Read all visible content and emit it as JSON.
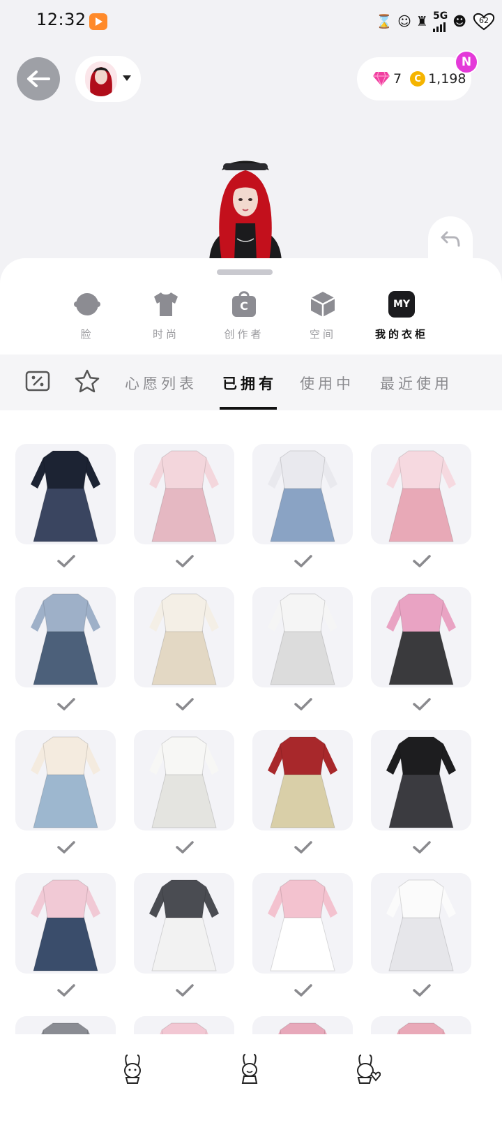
{
  "status_bar": {
    "time": "12:32",
    "battery": "62"
  },
  "wallet": {
    "gems": "7",
    "coins": "1,198",
    "coin_symbol": "C",
    "badge": "N"
  },
  "categories": [
    {
      "label": "脸",
      "icon": "face-icon"
    },
    {
      "label": "时尚",
      "icon": "tshirt-icon"
    },
    {
      "label": "创作者",
      "icon": "creator-bag-icon",
      "glyph": "C"
    },
    {
      "label": "空间",
      "icon": "space-cube-icon"
    },
    {
      "label": "我的衣柜",
      "icon": "my-closet-icon",
      "glyph": "MY",
      "active": true
    }
  ],
  "tabs": [
    {
      "label": "心愿列表"
    },
    {
      "label": "已拥有",
      "active": true
    },
    {
      "label": "使用中"
    },
    {
      "label": "最近使用"
    }
  ],
  "items": [
    {
      "name": "dark-starry-gown",
      "colors": [
        "#1c2333",
        "#3a4560"
      ],
      "owned": true
    },
    {
      "name": "pink-draped-dress",
      "colors": [
        "#f3d6dc",
        "#e5b8c2"
      ],
      "owned": true
    },
    {
      "name": "white-top-flare-jeans",
      "colors": [
        "#e9e9ee",
        "#8aa3c4"
      ],
      "owned": true
    },
    {
      "name": "cherry-blossom-set",
      "colors": [
        "#f6d9e0",
        "#e8a9b7"
      ],
      "owned": true
    },
    {
      "name": "denim-crop-set",
      "colors": [
        "#9eb0c8",
        "#4c607a"
      ],
      "owned": true
    },
    {
      "name": "white-lace-gown",
      "colors": [
        "#f4efe6",
        "#e3d8c4"
      ],
      "owned": true
    },
    {
      "name": "white-bubble-dress",
      "colors": [
        "#f5f5f5",
        "#dcdcdc"
      ],
      "owned": true
    },
    {
      "name": "pink-top-black-skirt",
      "colors": [
        "#e9a3c3",
        "#3a3a3d"
      ],
      "owned": true
    },
    {
      "name": "cream-top-blue-ruffle",
      "colors": [
        "#f4ebdf",
        "#9db7cf"
      ],
      "owned": true
    },
    {
      "name": "white-wrap-dress",
      "colors": [
        "#f7f7f5",
        "#e4e4e0"
      ],
      "owned": true
    },
    {
      "name": "red-embroidered-set",
      "colors": [
        "#a8282b",
        "#d9cfa8"
      ],
      "owned": true
    },
    {
      "name": "black-satin-mini",
      "colors": [
        "#1d1d1f",
        "#3b3b40"
      ],
      "owned": true
    },
    {
      "name": "tie-top-denim-skirt",
      "colors": [
        "#f1c9d5",
        "#3a4d6b"
      ],
      "owned": true
    },
    {
      "name": "school-vest-set",
      "colors": [
        "#4a4c52",
        "#f2f2f2"
      ],
      "owned": true
    },
    {
      "name": "striped-knit-top",
      "colors": [
        "#f3c2cf",
        "#ffffff"
      ],
      "owned": true
    },
    {
      "name": "white-satin-slip",
      "colors": [
        "#fbfbfb",
        "#e6e6ea"
      ],
      "owned": true
    },
    {
      "name": "partial-item-1",
      "colors": [
        "#8a8c93",
        "#f3f3f7"
      ],
      "owned": false
    },
    {
      "name": "partial-item-2",
      "colors": [
        "#f2c7d3",
        "#f3f3f7"
      ],
      "owned": false
    },
    {
      "name": "partial-item-3",
      "colors": [
        "#e7a8ba",
        "#f3f3f7"
      ],
      "owned": false
    },
    {
      "name": "partial-item-4",
      "colors": [
        "#e9a9b8",
        "#f3f3f7"
      ],
      "owned": false
    }
  ],
  "bottom_nav": [
    {
      "icon": "bunny-sticker-icon"
    },
    {
      "icon": "bunny-wave-icon"
    },
    {
      "icon": "bunny-heart-icon"
    }
  ]
}
